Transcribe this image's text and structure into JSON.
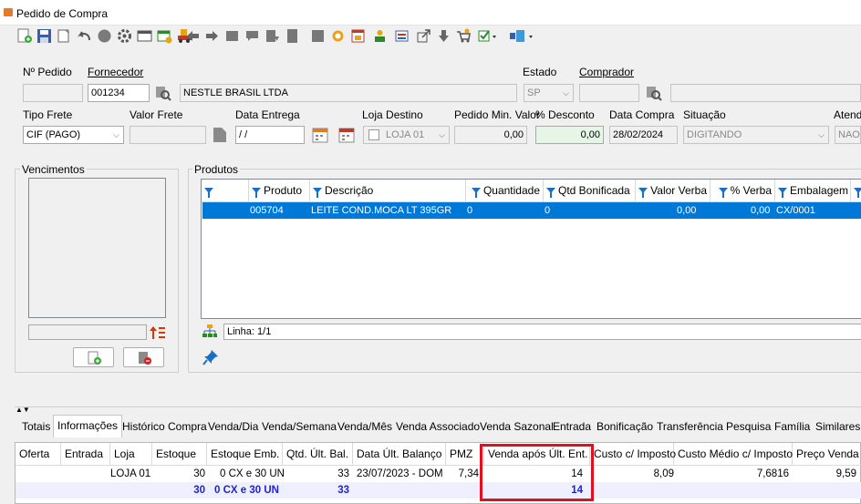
{
  "window": {
    "title": "Pedido de Compra"
  },
  "header": {
    "num_pedido_label": "Nº Pedido",
    "num_pedido_value": "",
    "fornecedor_label": "Fornecedor",
    "fornecedor_code": "001234",
    "fornecedor_name": "NESTLE BRASIL LTDA",
    "estado_label": "Estado",
    "estado_value": "SP",
    "comprador_label": "Comprador",
    "comprador_code": "",
    "comprador_name": ""
  },
  "row2": {
    "tipo_frete_label": "Tipo Frete",
    "tipo_frete_value": "CIF (PAGO)",
    "valor_frete_label": "Valor Frete",
    "valor_frete_value": "",
    "data_entrega_label": "Data Entrega",
    "data_entrega_value": " / /",
    "loja_destino_label": "Loja Destino",
    "loja_destino_value": "LOJA 01",
    "pedido_min_label": "Pedido Min. Valor",
    "pedido_min_value": "0,00",
    "desconto_label": "% Desconto",
    "desconto_value": "0,00",
    "data_compra_label": "Data Compra",
    "data_compra_value": "28/02/2024",
    "situacao_label": "Situação",
    "situacao_value": "DIGITANDO",
    "atend_label": "Atend",
    "atend_value": "NAO"
  },
  "vencimentos": {
    "title": "Vencimentos"
  },
  "produtos": {
    "title": "Produtos",
    "columns": [
      "Produto",
      "Descrição",
      "Quantidade",
      "Qtd Bonificada",
      "Valor Verba",
      "% Verba",
      "Embalagem"
    ],
    "row": {
      "produto": "005704",
      "descricao": "LEITE COND.MOCA LT 395GR",
      "quantidade": "0",
      "qtd_bonificada": "0",
      "valor_verba": "0,00",
      "pct_verba": "0,00",
      "embalagem": "CX/0001"
    },
    "linha_label": "Linha: 1/1"
  },
  "tabs": [
    "Totais",
    "Informações",
    "Histórico Compra",
    "Venda/Dia",
    "Venda/Semana",
    "Venda/Mês",
    "Venda Associado",
    "Venda Sazonal",
    "Entrada",
    "Bonificação",
    "Transferência",
    "Pesquisa",
    "Família",
    "Similares"
  ],
  "info_grid": {
    "columns": [
      "Oferta",
      "Entrada",
      "Loja",
      "Estoque",
      "Estoque Emb.",
      "Qtd. Últ. Bal.",
      "Data Últ. Balanço",
      "PMZ",
      "Venda após Últ. Ent.",
      "Custo c/ Imposto",
      "Custo Médio c/ Imposto",
      "Preço Venda"
    ],
    "row": {
      "oferta": "",
      "entrada": "",
      "loja": "LOJA 01",
      "estoque": "30",
      "estoque_emb": "0 CX e 30 UN",
      "qtd_ult_bal": "33",
      "data_ult_bal": "23/07/2023 - DOM",
      "pmz": "7,34",
      "venda_apos": "14",
      "custo_imposto": "8,09",
      "custo_medio": "7,6816",
      "preco_venda": "9,59"
    },
    "totals": {
      "estoque": "30",
      "estoque_emb": "0 CX e 30 UN",
      "qtd_ult_bal": "33",
      "venda_apos": "14"
    }
  },
  "colors": {
    "selection": "#0078d7",
    "highlight_box": "#e0101f",
    "totals_text": "#1f1fd6"
  }
}
